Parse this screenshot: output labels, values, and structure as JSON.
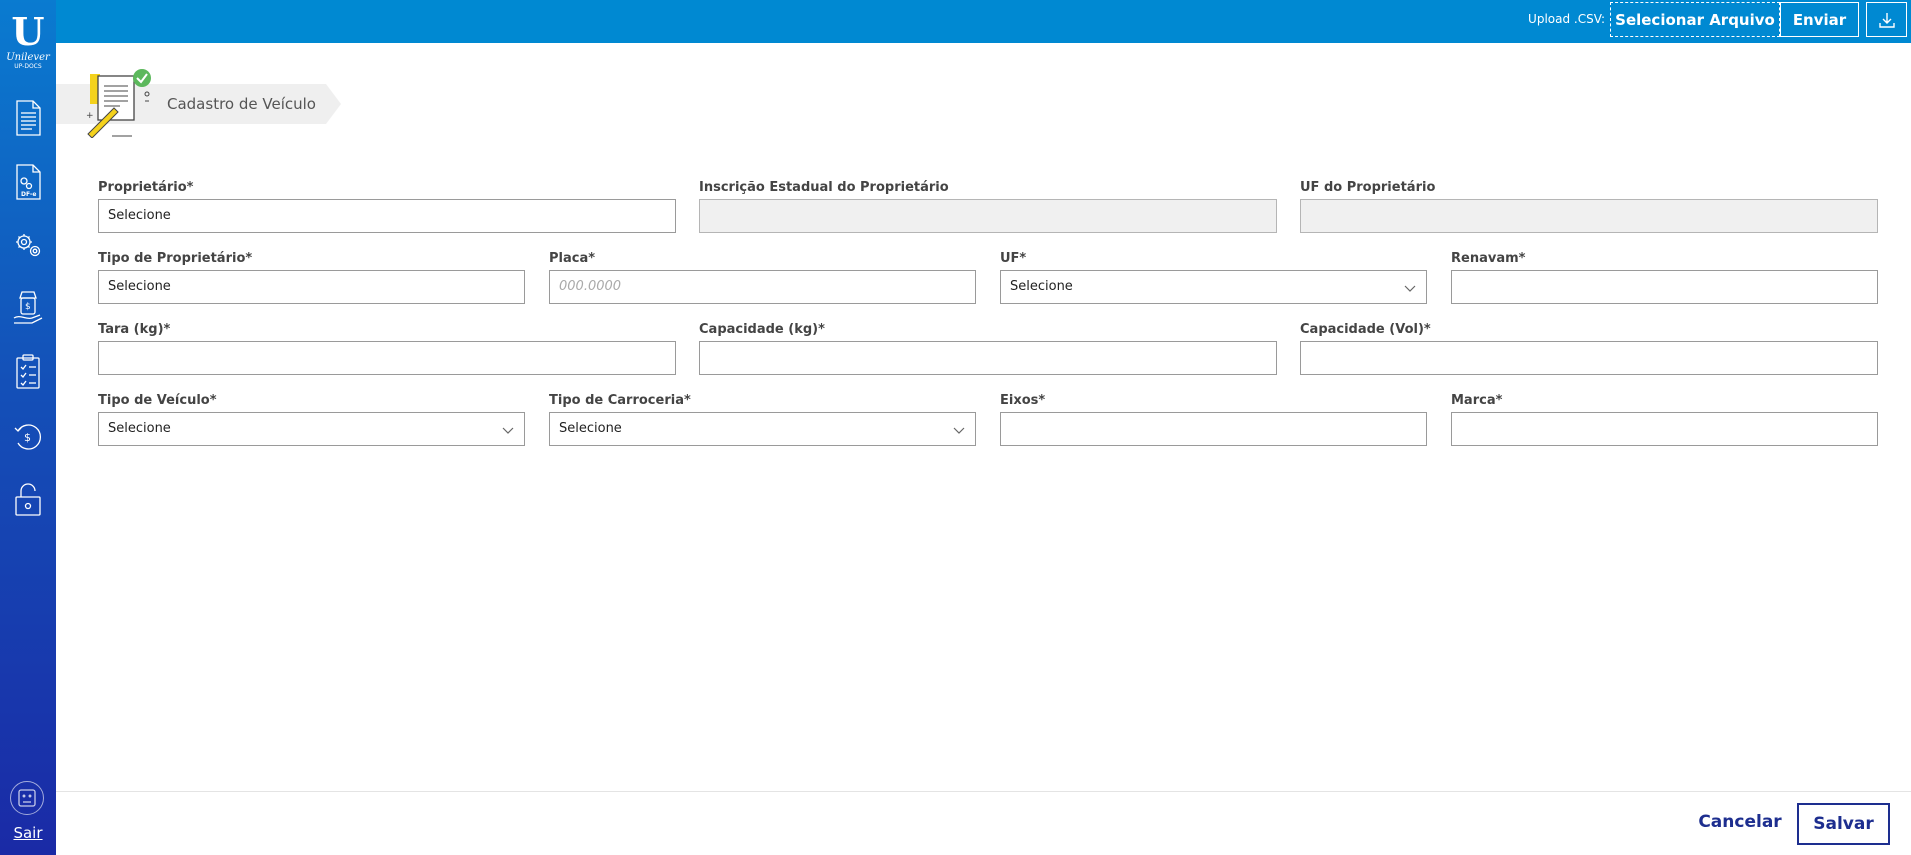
{
  "sidebar": {
    "logo": {
      "brand": "Unilever",
      "sub": "UP-DOCS"
    },
    "exit_label": "Sair"
  },
  "topbar": {
    "upload_label": "Upload .CSV:",
    "select_file_label": "Selecionar Arquivo",
    "send_label": "Enviar"
  },
  "page": {
    "title": "Cadastro de Veículo"
  },
  "form": {
    "proprietario": {
      "label": "Proprietário*",
      "value": "Selecione"
    },
    "inscricao": {
      "label": "Inscrição Estadual do Proprietário",
      "value": ""
    },
    "uf_proprietario": {
      "label": "UF do Proprietário",
      "value": ""
    },
    "tipo_proprietario": {
      "label": "Tipo de Proprietário*",
      "value": "Selecione"
    },
    "placa": {
      "label": "Placa*",
      "placeholder": "000.0000"
    },
    "uf": {
      "label": "UF*",
      "value": "Selecione"
    },
    "renavam": {
      "label": "Renavam*",
      "value": ""
    },
    "tara": {
      "label": "Tara (kg)*",
      "value": ""
    },
    "capacidade_kg": {
      "label": "Capacidade (kg)*",
      "value": ""
    },
    "capacidade_vol": {
      "label": "Capacidade (Vol)*",
      "value": ""
    },
    "tipo_veiculo": {
      "label": "Tipo de Veículo*",
      "value": "Selecione"
    },
    "tipo_carroceria": {
      "label": "Tipo de Carroceria*",
      "value": "Selecione"
    },
    "eixos": {
      "label": "Eixos*",
      "value": ""
    },
    "marca": {
      "label": "Marca*",
      "value": ""
    }
  },
  "footer": {
    "cancel_label": "Cancelar",
    "save_label": "Salvar"
  },
  "colors": {
    "topbar": "#0089d2",
    "sidebar_top": "#0a7bd0",
    "sidebar_bottom": "#1a2aa6",
    "accent": "#1d2e8f"
  }
}
